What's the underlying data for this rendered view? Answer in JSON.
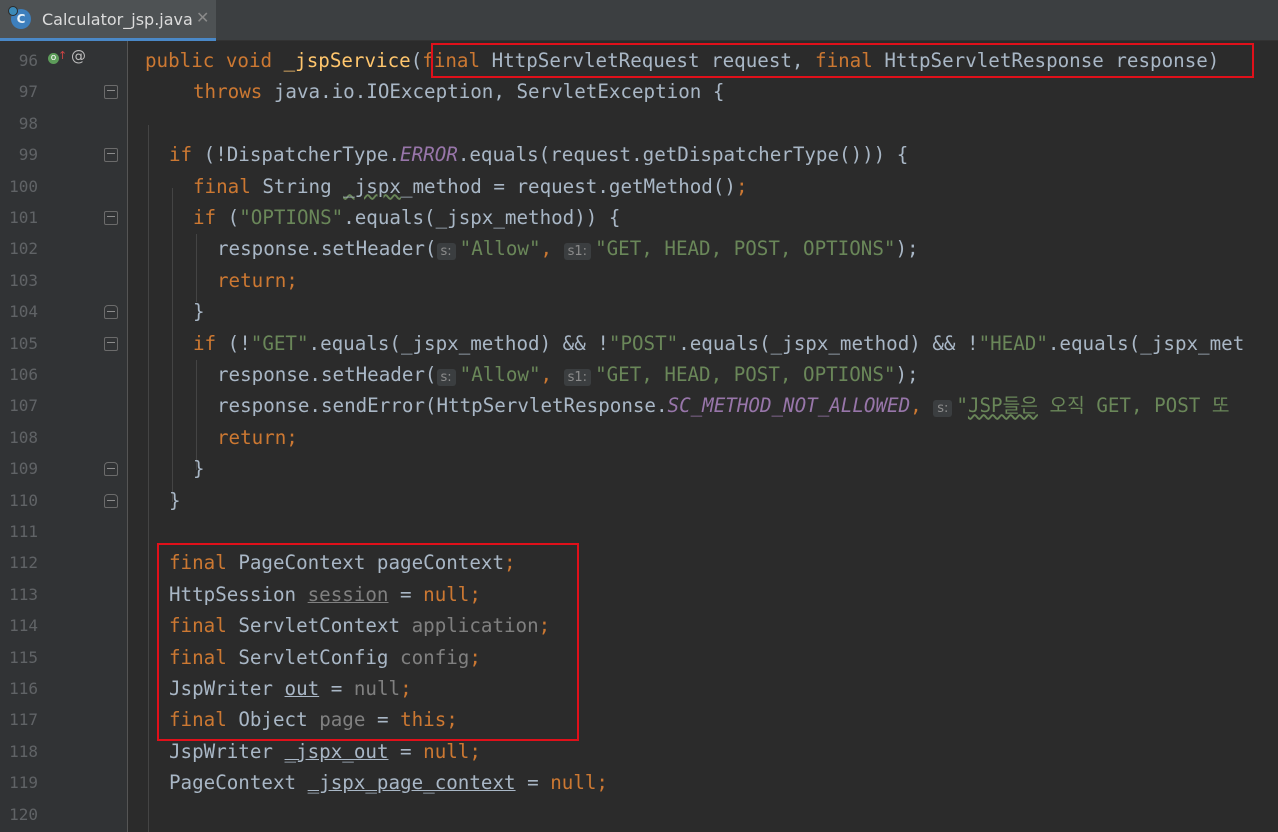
{
  "tab": {
    "title": "Calculator_jsp.java",
    "close": "✕",
    "icon": "C"
  },
  "gutter_markers": {
    "override": "o",
    "override_arrow": "↑",
    "annotation": "@"
  },
  "hints": {
    "s": "s:",
    "s1": "s1:"
  },
  "lines": [
    {
      "n": "96"
    },
    {
      "n": "97"
    },
    {
      "n": "98"
    },
    {
      "n": "99"
    },
    {
      "n": "100"
    },
    {
      "n": "101"
    },
    {
      "n": "102"
    },
    {
      "n": "103"
    },
    {
      "n": "104"
    },
    {
      "n": "105"
    },
    {
      "n": "106"
    },
    {
      "n": "107"
    },
    {
      "n": "108"
    },
    {
      "n": "109"
    },
    {
      "n": "110"
    },
    {
      "n": "111"
    },
    {
      "n": "112"
    },
    {
      "n": "113"
    },
    {
      "n": "114"
    },
    {
      "n": "115"
    },
    {
      "n": "116"
    },
    {
      "n": "117"
    },
    {
      "n": "118"
    },
    {
      "n": "119"
    },
    {
      "n": "120"
    }
  ],
  "code": {
    "l96": {
      "t1": "public void ",
      "t2": "_jspService",
      "t3": "(",
      "t4": "final ",
      "t5": "HttpServletRequest request, ",
      "t6": "final ",
      "t7": "HttpServletResponse response)"
    },
    "l97": {
      "t1": "throws ",
      "t2": "java.io.IOException, ServletException {"
    },
    "l99": {
      "t1": "if ",
      "t2": "(!DispatcherType.",
      "t3": "ERROR",
      "t4": ".equals(request.getDispatcherType())) {"
    },
    "l100": {
      "t1": "final ",
      "t2": "String ",
      "t3": "_jspx",
      "t4": "_method = request.getMethod()",
      "t5": ";"
    },
    "l101": {
      "t1": "if ",
      "t2": "(",
      "t3": "\"OPTIONS\"",
      "t4": ".equals(_jspx_method)) {"
    },
    "l102": {
      "t1": "response.setHeader(",
      "t2": "\"Allow\"",
      "t3": ", ",
      "t4": "\"GET, HEAD, POST, OPTIONS\"",
      "t5": ");"
    },
    "l103": {
      "t1": "return;"
    },
    "l104": {
      "t1": "}"
    },
    "l105": {
      "t1": "if ",
      "t2": "(!",
      "t3": "\"GET\"",
      "t4": ".equals(_jspx_method) && !",
      "t5": "\"POST\"",
      "t6": ".equals(_jspx_method) && !",
      "t7": "\"HEAD\"",
      "t8": ".equals(_jspx_met"
    },
    "l106": {
      "t1": "response.setHeader(",
      "t2": "\"Allow\"",
      "t3": ", ",
      "t4": "\"GET, HEAD, POST, OPTIONS\"",
      "t5": ");"
    },
    "l107": {
      "t1": "response.sendError(HttpServletResponse.",
      "t2": "SC_METHOD_NOT_ALLOWED",
      "t3": ", ",
      "t4": "\"",
      "t5": "JSP들은",
      "t6": " 오직 GET, POST 또"
    },
    "l108": {
      "t1": "return;"
    },
    "l109": {
      "t1": "}"
    },
    "l110": {
      "t1": "}"
    },
    "l112": {
      "t1": "final ",
      "t2": "PageContext pageContext",
      "t3": ";"
    },
    "l113": {
      "t1": "HttpSession ",
      "t2": "session",
      "t3": " = ",
      "t4": "null;"
    },
    "l114": {
      "t1": "final ",
      "t2": "ServletContext ",
      "t3": "application",
      "t4": ";"
    },
    "l115": {
      "t1": "final ",
      "t2": "ServletConfig ",
      "t3": "config",
      "t4": ";"
    },
    "l116": {
      "t1": "JspWriter ",
      "t2": "out",
      "t3": " = ",
      "t4": "null",
      "t5": ";"
    },
    "l117": {
      "t1": "final ",
      "t2": "Object ",
      "t3": "page",
      "t4": " = ",
      "t5": "this;"
    },
    "l118": {
      "t1": "JspWriter ",
      "t2": "_jspx_out",
      "t3": " = ",
      "t4": "null;"
    },
    "l119": {
      "t1": "PageContext ",
      "t2": "_jspx_page_context",
      "t3": " = ",
      "t4": "null;"
    }
  },
  "colors": {
    "keyword": "#cc7832",
    "string": "#6a8759",
    "constant": "#9876aa",
    "method": "#ffc66d",
    "highlight_box": "#e0101a"
  }
}
